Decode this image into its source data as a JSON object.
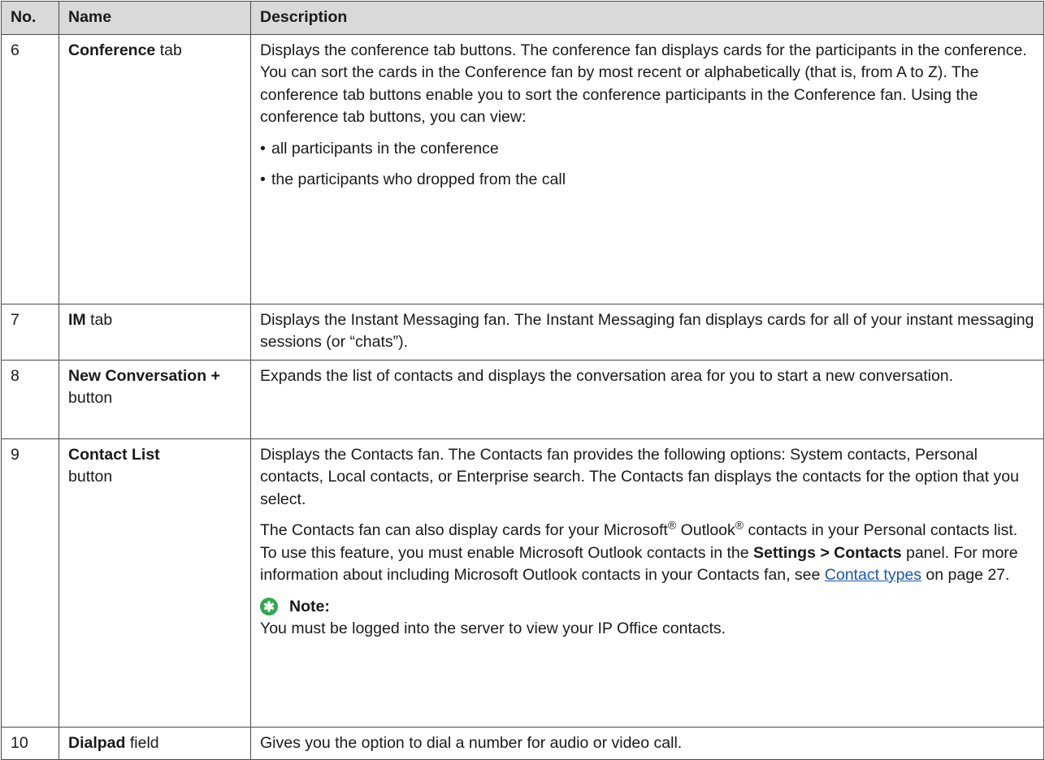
{
  "table": {
    "headers": [
      "No.",
      "Name",
      "Description"
    ],
    "rows": [
      {
        "no": "6",
        "name_bold": "Conference",
        "name_rest": " tab",
        "desc_p1": "Displays the conference tab buttons. The conference fan displays cards for the participants in the conference. You can sort the cards in the Conference fan by most recent or alphabetically (that is, from A to Z). The conference tab buttons enable you to sort the conference participants in the Conference fan. Using the conference tab buttons, you can view:",
        "bullets": [
          "all participants in the conference",
          "the participants who dropped from the call"
        ]
      },
      {
        "no": "7",
        "name_bold": "IM",
        "name_rest": " tab",
        "desc_p1": "Displays the Instant Messaging fan. The Instant Messaging fan displays cards for all of your instant messaging sessions (or “chats”)."
      },
      {
        "no": "8",
        "name_bold": "New Conversation +",
        "name_rest": "button",
        "desc_p1": "Expands the list of contacts and displays the conversation area for you to start a new conversation."
      },
      {
        "no": "9",
        "name_bold": "Contact List",
        "name_rest": "button",
        "desc_p1": "Displays the Contacts fan. The Contacts fan provides the following options: System contacts, Personal contacts, Local contacts, or Enterprise search. The Contacts fan displays the contacts for the option that you select.",
        "desc_p2_a": "The Contacts fan can also display cards for your Microsoft",
        "reg1": "®",
        "desc_p2_b": " Outlook",
        "reg2": "®",
        "desc_p2_c": " contacts in your Personal contacts list. To use this feature, you must enable Microsoft Outlook contacts in the ",
        "desc_p2_bold": "Settings > Contacts",
        "desc_p2_d": " panel. For more information about including Microsoft Outlook contacts in your Contacts fan, see ",
        "desc_p2_link": "Contact types",
        "desc_p2_e": " on page 27.",
        "note_label": "Note:",
        "note_text": "You must be logged into the server to view your IP Office contacts."
      },
      {
        "no": "10",
        "name_bold": "Dialpad",
        "name_rest": " field",
        "desc_p1": "Gives you the option to dial a number for audio or video call."
      }
    ]
  },
  "colors": {
    "header_bg": "#d9d9d9",
    "border": "#4a4a4a",
    "link": "#1a55b5",
    "note_icon": "#2ea84a"
  },
  "icons": {
    "note": "star-note-icon"
  }
}
